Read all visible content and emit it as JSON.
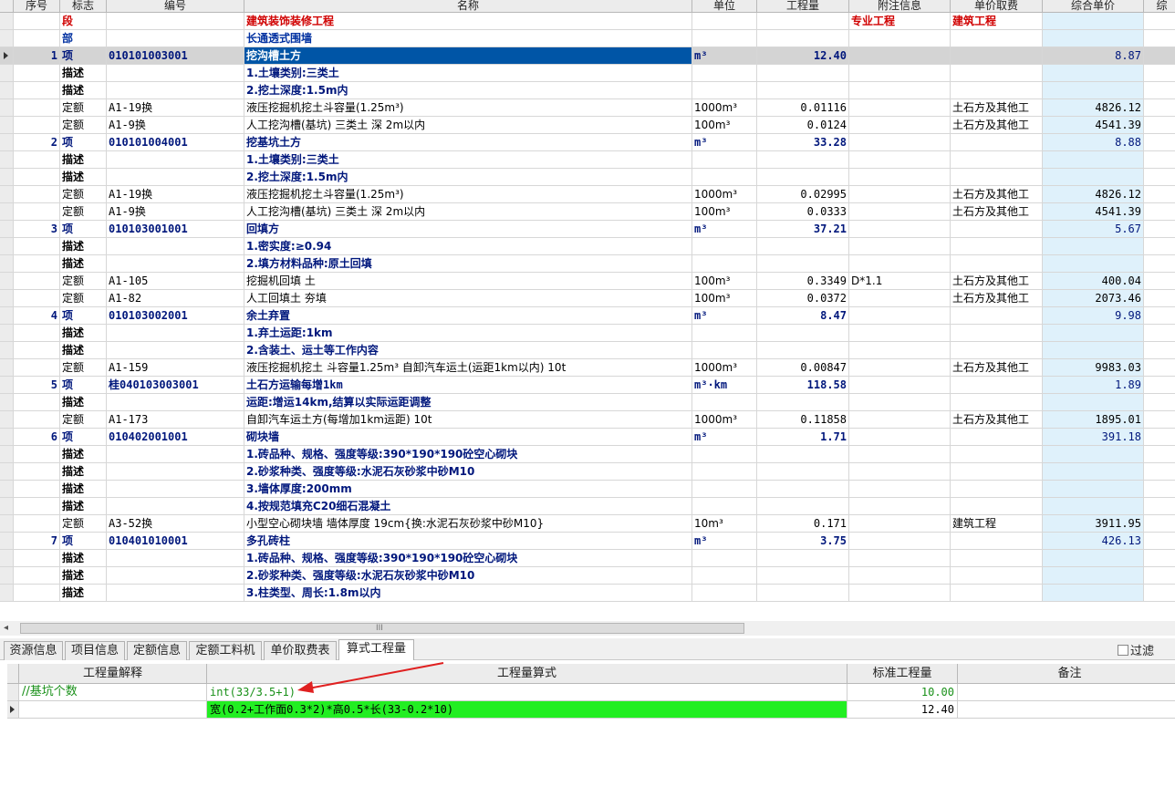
{
  "main_table": {
    "columns": [
      "序号",
      "标志",
      "编号",
      "名称",
      "单位",
      "工程量",
      "附注信息",
      "单价取费",
      "综合单价",
      "综"
    ],
    "rows": [
      {
        "type": "seg",
        "no": "",
        "flag": "段",
        "code": "",
        "name": "建筑装饰装修工程",
        "unit": "",
        "qty": "",
        "note": "专业工程",
        "fee": "建筑工程",
        "price": ""
      },
      {
        "type": "part",
        "no": "",
        "flag": "部",
        "code": "",
        "name": "长通透式围墙",
        "unit": "",
        "qty": "",
        "note": "",
        "fee": "",
        "price": ""
      },
      {
        "type": "item",
        "selected": true,
        "no": "1",
        "flag": "项",
        "code": "010101003001",
        "name": "挖沟槽土方",
        "unit": "m³",
        "qty": "12.40",
        "note": "",
        "fee": "",
        "price": "8.87"
      },
      {
        "type": "desc",
        "no": "",
        "flag": "描述",
        "code": "",
        "name": "1.土壤类别:三类土",
        "unit": "",
        "qty": "",
        "note": "",
        "fee": "",
        "price": ""
      },
      {
        "type": "desc",
        "no": "",
        "flag": "描述",
        "code": "",
        "name": "2.挖土深度:1.5m内",
        "unit": "",
        "qty": "",
        "note": "",
        "fee": "",
        "price": ""
      },
      {
        "type": "quota",
        "no": "",
        "flag": "定额",
        "code": "A1-19换",
        "name": "液压挖掘机挖土斗容量(1.25m³)",
        "unit": "1000m³",
        "qty": "0.01116",
        "note": "",
        "fee": "土石方及其他工",
        "price": "4826.12"
      },
      {
        "type": "quota",
        "no": "",
        "flag": "定额",
        "code": "A1-9换",
        "name": "人工挖沟槽(基坑) 三类土 深 2m以内",
        "unit": "100m³",
        "qty": "0.0124",
        "note": "",
        "fee": "土石方及其他工",
        "price": "4541.39"
      },
      {
        "type": "item",
        "no": "2",
        "flag": "项",
        "code": "010101004001",
        "name": "挖基坑土方",
        "unit": "m³",
        "qty": "33.28",
        "note": "",
        "fee": "",
        "price": "8.88"
      },
      {
        "type": "desc",
        "no": "",
        "flag": "描述",
        "code": "",
        "name": "1.土壤类别:三类土",
        "unit": "",
        "qty": "",
        "note": "",
        "fee": "",
        "price": ""
      },
      {
        "type": "desc",
        "no": "",
        "flag": "描述",
        "code": "",
        "name": "2.挖土深度:1.5m内",
        "unit": "",
        "qty": "",
        "note": "",
        "fee": "",
        "price": ""
      },
      {
        "type": "quota",
        "no": "",
        "flag": "定额",
        "code": "A1-19换",
        "name": "液压挖掘机挖土斗容量(1.25m³)",
        "unit": "1000m³",
        "qty": "0.02995",
        "note": "",
        "fee": "土石方及其他工",
        "price": "4826.12"
      },
      {
        "type": "quota",
        "no": "",
        "flag": "定额",
        "code": "A1-9换",
        "name": "人工挖沟槽(基坑) 三类土 深 2m以内",
        "unit": "100m³",
        "qty": "0.0333",
        "note": "",
        "fee": "土石方及其他工",
        "price": "4541.39"
      },
      {
        "type": "item",
        "no": "3",
        "flag": "项",
        "code": "010103001001",
        "name": "回填方",
        "unit": "m³",
        "qty": "37.21",
        "note": "",
        "fee": "",
        "price": "5.67"
      },
      {
        "type": "desc",
        "no": "",
        "flag": "描述",
        "code": "",
        "name": "1.密实度:≥0.94",
        "unit": "",
        "qty": "",
        "note": "",
        "fee": "",
        "price": ""
      },
      {
        "type": "desc",
        "no": "",
        "flag": "描述",
        "code": "",
        "name": "2.填方材料品种:原土回填",
        "unit": "",
        "qty": "",
        "note": "",
        "fee": "",
        "price": ""
      },
      {
        "type": "quota",
        "no": "",
        "flag": "定额",
        "code": "A1-105",
        "name": "挖掘机回填 土",
        "unit": "100m³",
        "qty": "0.3349",
        "note": "D*1.1",
        "fee": "土石方及其他工",
        "price": "400.04"
      },
      {
        "type": "quota",
        "no": "",
        "flag": "定额",
        "code": "A1-82",
        "name": "人工回填土 夯填",
        "unit": "100m³",
        "qty": "0.0372",
        "note": "",
        "fee": "土石方及其他工",
        "price": "2073.46"
      },
      {
        "type": "item",
        "no": "4",
        "flag": "项",
        "code": "010103002001",
        "name": "余土弃置",
        "unit": "m³",
        "qty": "8.47",
        "note": "",
        "fee": "",
        "price": "9.98"
      },
      {
        "type": "desc",
        "no": "",
        "flag": "描述",
        "code": "",
        "name": "1.弃土运距:1km",
        "unit": "",
        "qty": "",
        "note": "",
        "fee": "",
        "price": ""
      },
      {
        "type": "desc",
        "no": "",
        "flag": "描述",
        "code": "",
        "name": "2.含装土、运土等工作内容",
        "unit": "",
        "qty": "",
        "note": "",
        "fee": "",
        "price": ""
      },
      {
        "type": "quota",
        "no": "",
        "flag": "定额",
        "code": "A1-159",
        "name": "液压挖掘机挖土 斗容量1.25m³ 自卸汽车运土(运距1km以内) 10t",
        "unit": "1000m³",
        "qty": "0.00847",
        "note": "",
        "fee": "土石方及其他工",
        "price": "9983.03"
      },
      {
        "type": "item",
        "no": "5",
        "flag": "项",
        "code": "桂040103003001",
        "name": "土石方运输每增1km",
        "unit": "m³·km",
        "qty": "118.58",
        "note": "",
        "fee": "",
        "price": "1.89"
      },
      {
        "type": "desc",
        "no": "",
        "flag": "描述",
        "code": "",
        "name": "运距:增运14km,结算以实际运距调整",
        "unit": "",
        "qty": "",
        "note": "",
        "fee": "",
        "price": ""
      },
      {
        "type": "quota",
        "no": "",
        "flag": "定额",
        "code": "A1-173",
        "name": "自卸汽车运土方(每增加1km运距) 10t",
        "unit": "1000m³",
        "qty": "0.11858",
        "note": "",
        "fee": "土石方及其他工",
        "price": "1895.01"
      },
      {
        "type": "item",
        "no": "6",
        "flag": "项",
        "code": "010402001001",
        "name": "砌块墙",
        "unit": "m³",
        "qty": "1.71",
        "note": "",
        "fee": "",
        "price": "391.18"
      },
      {
        "type": "desc",
        "no": "",
        "flag": "描述",
        "code": "",
        "name": "1.砖品种、规格、强度等级:390*190*190砼空心砌块",
        "unit": "",
        "qty": "",
        "note": "",
        "fee": "",
        "price": ""
      },
      {
        "type": "desc",
        "no": "",
        "flag": "描述",
        "code": "",
        "name": "2.砂浆种类、强度等级:水泥石灰砂浆中砂M10",
        "unit": "",
        "qty": "",
        "note": "",
        "fee": "",
        "price": ""
      },
      {
        "type": "desc",
        "no": "",
        "flag": "描述",
        "code": "",
        "name": "3.墙体厚度:200mm",
        "unit": "",
        "qty": "",
        "note": "",
        "fee": "",
        "price": ""
      },
      {
        "type": "desc",
        "no": "",
        "flag": "描述",
        "code": "",
        "name": "4.按规范填充C20细石混凝土",
        "unit": "",
        "qty": "",
        "note": "",
        "fee": "",
        "price": ""
      },
      {
        "type": "quota",
        "no": "",
        "flag": "定额",
        "code": "A3-52换",
        "name": "小型空心砌块墙 墙体厚度 19cm{换:水泥石灰砂浆中砂M10}",
        "unit": "10m³",
        "qty": "0.171",
        "note": "",
        "fee": "建筑工程",
        "price": "3911.95"
      },
      {
        "type": "item",
        "no": "7",
        "flag": "项",
        "code": "010401010001",
        "name": "多孔砖柱",
        "unit": "m³",
        "qty": "3.75",
        "note": "",
        "fee": "",
        "price": "426.13"
      },
      {
        "type": "desc",
        "no": "",
        "flag": "描述",
        "code": "",
        "name": "1.砖品种、规格、强度等级:390*190*190砼空心砌块",
        "unit": "",
        "qty": "",
        "note": "",
        "fee": "",
        "price": ""
      },
      {
        "type": "desc",
        "no": "",
        "flag": "描述",
        "code": "",
        "name": "2.砂浆种类、强度等级:水泥石灰砂浆中砂M10",
        "unit": "",
        "qty": "",
        "note": "",
        "fee": "",
        "price": ""
      },
      {
        "type": "desc",
        "no": "",
        "flag": "描述",
        "code": "",
        "name": "3.柱类型、周长:1.8m以内",
        "unit": "",
        "qty": "",
        "note": "",
        "fee": "",
        "price": ""
      }
    ]
  },
  "scrollbar": {
    "left_arrow": "◂",
    "grip": "III"
  },
  "tabs": [
    "资源信息",
    "项目信息",
    "定额信息",
    "定额工料机",
    "单价取费表",
    "算式工程量"
  ],
  "active_tab": "算式工程量",
  "filter": {
    "label": "过滤"
  },
  "formula_table": {
    "columns": [
      "工程量解释",
      "工程量算式",
      "标准工程量",
      "备注"
    ],
    "rows": [
      {
        "explain": "//基坑个数",
        "formula": "int(33/3.5+1)",
        "std": "10.00",
        "remark": ""
      },
      {
        "explain": "",
        "formula": "宽(0.2+工作面0.3*2)*高0.5*长(33-0.2*10)",
        "std": "12.40",
        "remark": ""
      }
    ]
  },
  "colors": {
    "selected_cell": "#0055a6",
    "price_column": "#dff1fb",
    "formula_highlight": "#22ee22",
    "arrow": "#e02020"
  }
}
